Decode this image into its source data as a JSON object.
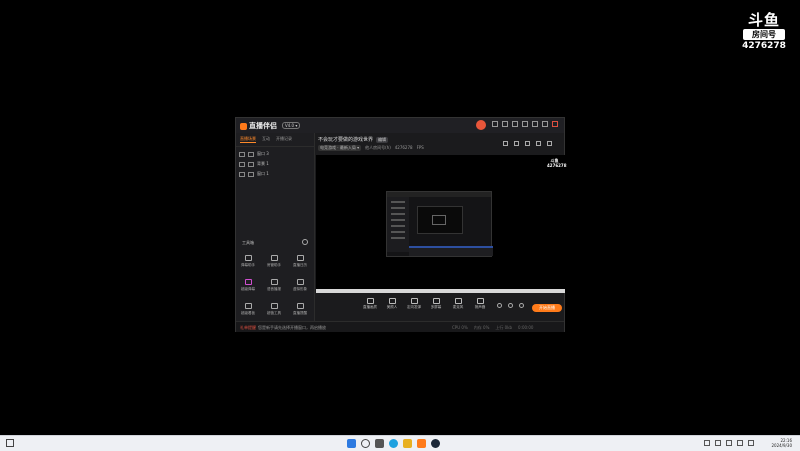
{
  "watermark": {
    "logo": "斗鱼",
    "room_label": "房间号",
    "room_id": "4276278"
  },
  "app": {
    "title": "直播伴侣",
    "version_badge": "V4.0 ▾",
    "left_tabs": [
      "直播场景",
      "互动",
      "开播记录"
    ],
    "scenes": [
      "窗口 3",
      "背景 1",
      "窗口 1"
    ],
    "tools_header": "工具箱",
    "tools": [
      {
        "label": "弹幕助手"
      },
      {
        "label": "房管助手"
      },
      {
        "label": "直播日历"
      },
      {
        "label": "超级弹幕"
      },
      {
        "label": "语音播报"
      },
      {
        "label": "虚拟形象"
      },
      {
        "label": "超级看板"
      },
      {
        "label": "超值工具"
      },
      {
        "label": "直播提醒"
      }
    ],
    "stream_title": "不会玩才要做的游戏世界",
    "edit_label": "编辑",
    "meta": {
      "category": "电竞游戏 · 最新入局 ▾",
      "room_prefix": "他人房间号(h)",
      "room_number": "4276278",
      "fps": "FPS"
    },
    "bottom_tools": [
      {
        "label": "直播画质"
      },
      {
        "label": "美颜人"
      },
      {
        "label": "定向发弹"
      },
      {
        "label": "多屏幕"
      },
      {
        "label": "麦克风"
      },
      {
        "label": "扬声器"
      }
    ],
    "live_button": "开始直播",
    "status": {
      "warning_label": "礼单提醒",
      "text": "您是新手请先选择开播窗口，再启播放",
      "right": [
        "CPU 0%",
        "内存 0%",
        "上行 0kb",
        "0:00:00"
      ]
    }
  },
  "taskbar": {
    "time": "22:16",
    "date": "2024/9/30"
  },
  "colors": {
    "accent": "#ff7b1a",
    "warning": "#e05040"
  }
}
